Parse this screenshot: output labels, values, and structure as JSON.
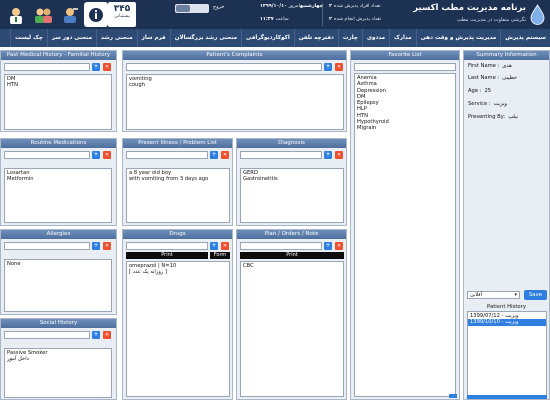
{
  "header": {
    "title": "برنامه مدیریت مطب اکسیر",
    "subtitle": "نگرشی متفاوت در مدیریت مطب",
    "stats": [
      {
        "label": "تعداد افراد پذیرش شده",
        "value": "۲"
      },
      {
        "label": "تعداد پذیرش انجام شده",
        "value": "۲"
      },
      {
        "label": "امروز",
        "value": "۱۳۹۹/۱۰/۱۰ چهارشنبه"
      },
      {
        "label": "ساعت",
        "value": "۱۱:۳۷"
      }
    ],
    "counter_value": "۳۴۵",
    "counter_label": "پشتیبانی",
    "logout_label": "خروج",
    "accent_color": "#1d3252"
  },
  "nav": {
    "items": [
      "سیستم پذیرش",
      "مدیریت پذیرش و وقت دهی",
      "مدارک",
      "مددوی",
      "چارت",
      "دفترچه تلفن",
      "اکوکاردیوگرافی",
      "منحنی رشد بزرگسالان",
      "فرم ساز",
      "منحنی رشد",
      "منحنی دور سر",
      "چک لیست"
    ]
  },
  "panels": {
    "past_history": {
      "title": "Past Medical History - Familial History",
      "items": [
        "DM",
        "HTN"
      ]
    },
    "complaints": {
      "title": "Patient's Complaints",
      "items": [
        "vomiting",
        "cough"
      ]
    },
    "favorite": {
      "title": "Favorite List",
      "items": [
        "Anemia",
        "Asthma",
        "Depression",
        "DM",
        "Epilepsy",
        "HLP",
        "HTN",
        "Hypothyroid",
        "Migrain"
      ]
    },
    "routine_meds": {
      "title": "Routine Medications",
      "items": [
        "Losartan",
        "Metformin"
      ]
    },
    "present_illness": {
      "title": "Present Illness / Problem List",
      "items": [
        "a 8 year old boy",
        "with vomiting from 3 days ago"
      ]
    },
    "diagnosis": {
      "title": "Diagnosis",
      "items": [
        "GERD",
        "Gastroinetitis"
      ]
    },
    "allergies": {
      "title": "Allergies",
      "items": [
        "None"
      ]
    },
    "drugs": {
      "title": "Drugs",
      "print_label": "Print",
      "form_label": "Form",
      "items": [
        "omeprazol | N=10",
        "[ روزانه یک عدد ]"
      ]
    },
    "plan": {
      "title": "Plan / Orders / Note",
      "print_label": "Print",
      "items": [
        "CBC"
      ]
    },
    "social": {
      "title": "Social History",
      "items": [
        "Passive Smoker",
        "داخل آمور"
      ]
    }
  },
  "summary": {
    "title": "Summary Information",
    "first_name_label": "First Name :",
    "first_name": "هدی",
    "last_name_label": "Last Name :",
    "last_name": "خطیبی",
    "age_label": "Age :",
    "age": "25",
    "service_label": "Service :",
    "service": "ویزیت",
    "presenting_label": "Presenting By:",
    "presenting": "نیلپ",
    "select_value": "آفلاین",
    "save_label": "Save",
    "history_title": "Patient History",
    "history_items": [
      "ویزیت - 1399/07/12",
      "ویزیت - 1399/10/10"
    ]
  }
}
